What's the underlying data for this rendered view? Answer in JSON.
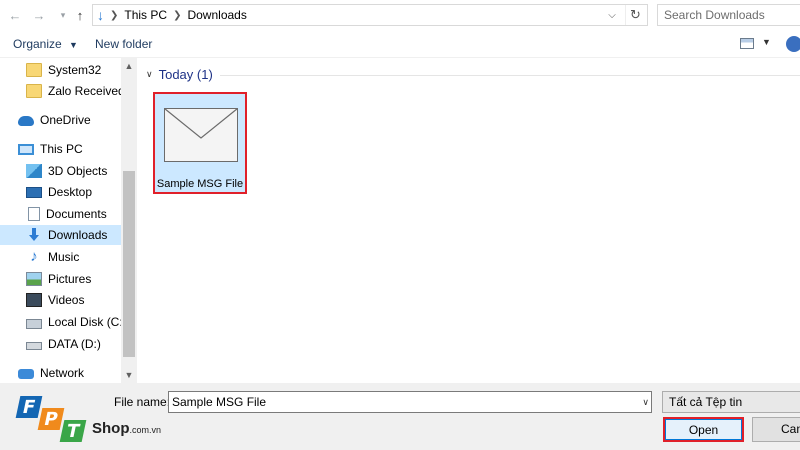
{
  "address_bar": {
    "crumbs": [
      "This PC",
      "Downloads"
    ],
    "search_placeholder": "Search Downloads"
  },
  "toolbar": {
    "organize_label": "Organize",
    "new_folder_label": "New folder"
  },
  "nav_pane": {
    "items": [
      {
        "label": "System32",
        "icon": "folder-icon"
      },
      {
        "label": "Zalo Received Fi",
        "icon": "folder-icon"
      },
      {
        "label": "OneDrive",
        "icon": "onedrive-icon"
      },
      {
        "label": "This PC",
        "icon": "pc-icon"
      },
      {
        "label": "3D Objects",
        "icon": "3d-objects-icon"
      },
      {
        "label": "Desktop",
        "icon": "desktop-icon"
      },
      {
        "label": "Documents",
        "icon": "documents-icon"
      },
      {
        "label": "Downloads",
        "icon": "downloads-icon",
        "selected": true
      },
      {
        "label": "Music",
        "icon": "music-icon"
      },
      {
        "label": "Pictures",
        "icon": "pictures-icon"
      },
      {
        "label": "Videos",
        "icon": "videos-icon"
      },
      {
        "label": "Local Disk (C:)",
        "icon": "local-disk-icon"
      },
      {
        "label": "DATA (D:)",
        "icon": "drive-icon"
      },
      {
        "label": "Network",
        "icon": "network-icon"
      }
    ]
  },
  "content": {
    "group_label": "Today (1)",
    "files": [
      {
        "name": "Sample MSG File",
        "icon": "envelope-icon",
        "selected": true
      }
    ]
  },
  "footer": {
    "file_name_label": "File name:",
    "file_name_value": "Sample MSG File",
    "file_type_value": "Tất cả Tệp tin",
    "open_label": "Open",
    "cancel_label": "Canc"
  },
  "watermark": {
    "letters": [
      "F",
      "P",
      "T"
    ],
    "shop_text": "Shop",
    "shop_suffix": ".com.vn"
  },
  "colors": {
    "selection": "#cce8ff",
    "highlight_border": "#e0202a",
    "group_header": "#1e3287",
    "logo_blue": "#1366b3",
    "logo_orange": "#f08a1c",
    "logo_green": "#3aa648"
  }
}
